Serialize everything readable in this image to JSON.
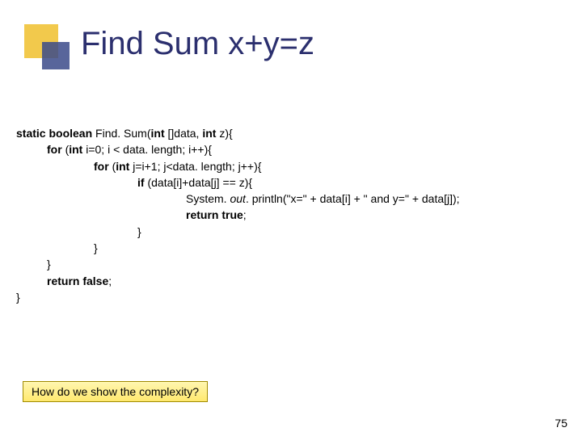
{
  "slide": {
    "title": "Find Sum x+y=z",
    "page_number": "75",
    "question": "How do we show the complexity?"
  },
  "code": {
    "l1a": "static boolean ",
    "l1b": "Find. Sum(",
    "l1c": "int ",
    "l1d": "[]data, ",
    "l1e": "int ",
    "l1f": "z){",
    "l2a": "for ",
    "l2b": "(",
    "l2c": "int ",
    "l2d": "i=0; i < data. length; i++){",
    "l3a": "for ",
    "l3b": "(",
    "l3c": "int ",
    "l3d": "j=i+1; j<data. length; j++){",
    "l4a": "if ",
    "l4b": "(data[i]+data[j] == z){",
    "l5a": "System. ",
    "l5b": "out",
    "l5c": ". println(\"x=\" + data[i] + \" and y=\" + data[j]);",
    "l6a": "return true",
    "l6b": ";",
    "l7": "}",
    "l8": "}",
    "l9": "}",
    "l10a": "return false",
    "l10b": ";",
    "l11": "}"
  }
}
